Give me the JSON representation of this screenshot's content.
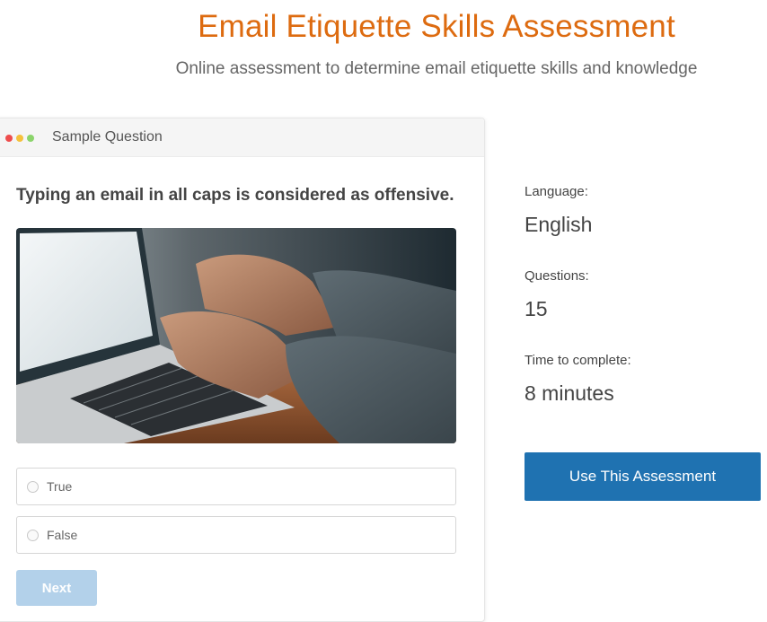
{
  "header": {
    "title": "Email Etiquette Skills Assessment",
    "subtitle": "Online assessment to determine email etiquette skills and knowledge"
  },
  "question_card": {
    "window_title": "Sample Question",
    "question": "Typing an email in all caps is considered as offensive.",
    "image_subject": "hands-typing-on-laptop",
    "options": [
      {
        "label": "True",
        "selected": false
      },
      {
        "label": "False",
        "selected": false
      }
    ],
    "next_label": "Next"
  },
  "info": {
    "language_label": "Language:",
    "language_value": "English",
    "questions_label": "Questions:",
    "questions_value": "15",
    "time_label": "Time to complete:",
    "time_value": "8 minutes"
  },
  "cta": {
    "label": "Use This Assessment"
  },
  "colors": {
    "title": "#dd6b10",
    "primary_button": "#1f72b1",
    "next_button_disabled": "#b3d1ea"
  }
}
